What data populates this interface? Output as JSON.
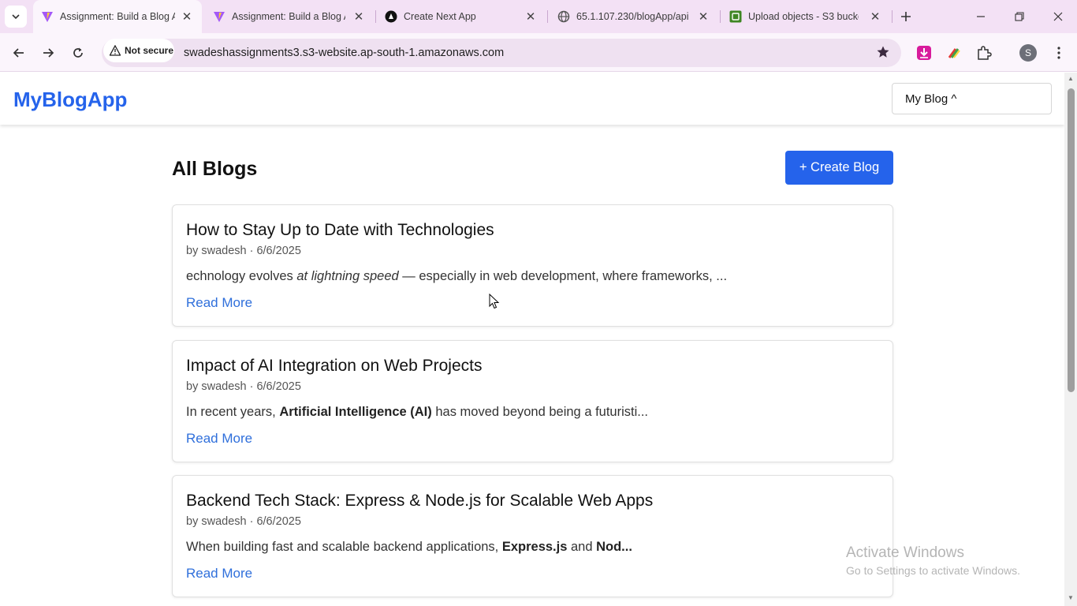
{
  "browser": {
    "tabs": [
      {
        "title": "Assignment: Build a Blog Ap",
        "favicon": "vite-icon",
        "active": true
      },
      {
        "title": "Assignment: Build a Blog Ap",
        "favicon": "vite-icon",
        "active": false
      },
      {
        "title": "Create Next App",
        "favicon": "nextjs-icon",
        "active": false
      },
      {
        "title": "65.1.107.230/blogApp/api",
        "favicon": "globe-icon",
        "active": false
      },
      {
        "title": "Upload objects - S3 bucket",
        "favicon": "s3-icon",
        "active": false
      }
    ],
    "security_label": "Not secure",
    "url": "swadeshassignments3.s3-website.ap-south-1.amazonaws.com",
    "profile_initial": "S"
  },
  "app": {
    "brand": "MyBlogApp",
    "nav_dropdown_label": "My Blog ^",
    "page_heading": "All Blogs",
    "create_button": "+ Create Blog",
    "read_more": "Read More",
    "posts": [
      {
        "title": "How to Stay Up to Date with Technologies",
        "meta": "by swadesh · 6/6/2025",
        "excerpt_parts": [
          {
            "text": "echnology evolves ",
            "style": "normal"
          },
          {
            "text": "at lightning speed",
            "style": "italic"
          },
          {
            "text": " — especially in web development, where frameworks, ...",
            "style": "normal"
          }
        ]
      },
      {
        "title": "Impact of AI Integration on Web Projects",
        "meta": "by swadesh · 6/6/2025",
        "excerpt_parts": [
          {
            "text": "In recent years, ",
            "style": "normal"
          },
          {
            "text": "Artificial Intelligence (AI)",
            "style": "bold"
          },
          {
            "text": " has moved beyond being a futuristi...",
            "style": "normal"
          }
        ]
      },
      {
        "title": "Backend Tech Stack: Express & Node.js for Scalable Web Apps",
        "meta": "by swadesh · 6/6/2025",
        "excerpt_parts": [
          {
            "text": "When building fast and scalable backend applications, ",
            "style": "normal"
          },
          {
            "text": "Express.js",
            "style": "bold"
          },
          {
            "text": " and ",
            "style": "normal"
          },
          {
            "text": "Nod...",
            "style": "bold"
          }
        ]
      }
    ]
  },
  "os": {
    "watermark_title": "Activate Windows",
    "watermark_subtitle": "Go to Settings to activate Windows."
  },
  "colors": {
    "brand_blue": "#2563eb",
    "link_blue": "#2f6fdb",
    "tabstrip_bg": "#f3e1f5"
  }
}
